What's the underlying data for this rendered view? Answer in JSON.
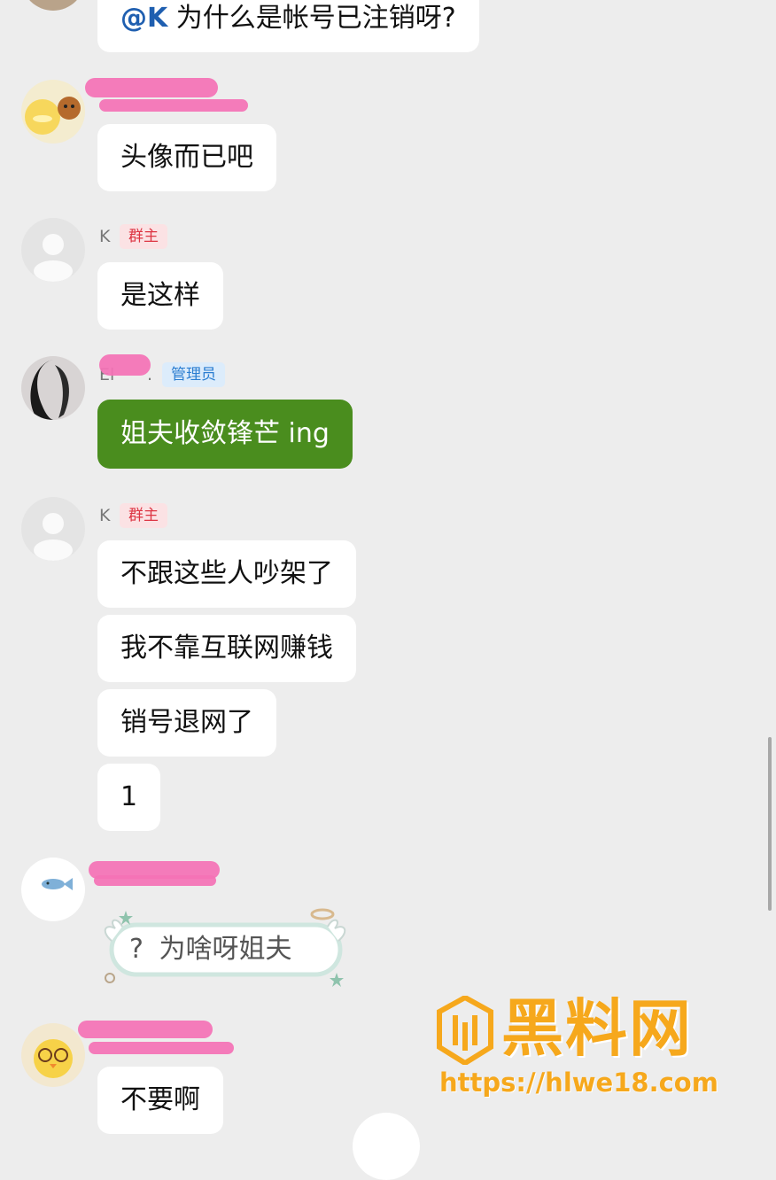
{
  "messages": {
    "m1": "为什么是帐号已注销呀?",
    "m1_mention": "@K",
    "m2": "头像而已吧",
    "m3": "是这样",
    "m4": "姐夫收敛锋芒 ing",
    "m5": "不跟这些人吵架了",
    "m6": "我不靠互联网赚钱",
    "m7": "销号退网了",
    "m8": "1",
    "m9": "为啥呀姐夫",
    "m9_q": "?",
    "m10": "不要啊"
  },
  "senders": {
    "k_name": "K",
    "owner_badge": "群主",
    "admin_name_fragment": "El",
    "admin_name_tail": ".",
    "admin_badge": "管理员"
  },
  "watermark": {
    "brand": "黑料网",
    "url": "https://hlwe18.com"
  },
  "colors": {
    "background": "#ededed",
    "bubble": "#ffffff",
    "admin_bubble": "#4a8d1e",
    "owner_badge": "#dd3543",
    "admin_badge": "#2b7ed1",
    "mention": "#1f5fb0",
    "watermark": "#f6a81c"
  }
}
